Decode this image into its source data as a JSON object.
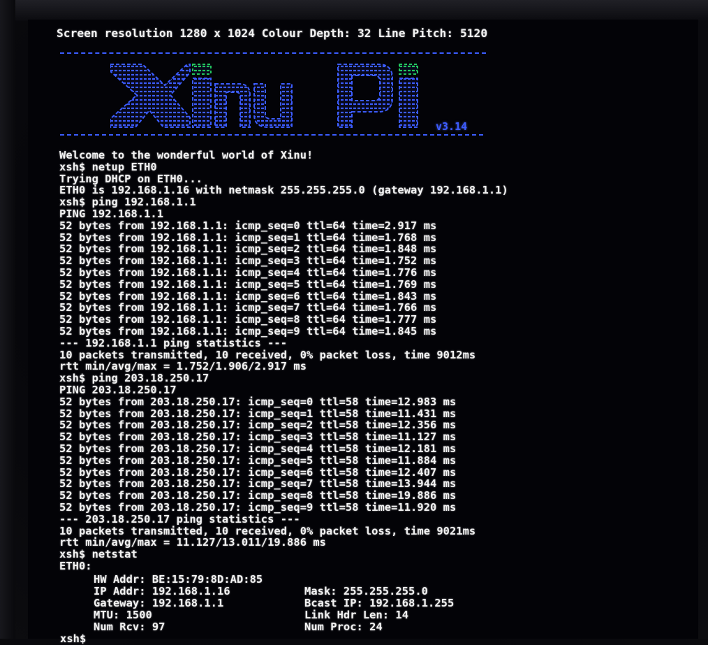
{
  "header": {
    "resolution_line": "Screen resolution 1280 x 1024 Colour Depth: 32 Line Pitch: 5120"
  },
  "logo": {
    "text": "Xinu Pi",
    "version": "v3.14",
    "colors": {
      "primary": "#3b5cff",
      "accent": "#22c55e"
    }
  },
  "console": {
    "lines": [
      "Welcome to the wonderful world of Xinu!",
      "xsh$ netup ETH0",
      "Trying DHCP on ETH0...",
      "ETH0 is 192.168.1.16 with netmask 255.255.255.0 (gateway 192.168.1.1)",
      "xsh$ ping 192.168.1.1",
      "PING 192.168.1.1",
      "52 bytes from 192.168.1.1: icmp_seq=0 ttl=64 time=2.917 ms",
      "52 bytes from 192.168.1.1: icmp_seq=1 ttl=64 time=1.768 ms",
      "52 bytes from 192.168.1.1: icmp_seq=2 ttl=64 time=1.848 ms",
      "52 bytes from 192.168.1.1: icmp_seq=3 ttl=64 time=1.752 ms",
      "52 bytes from 192.168.1.1: icmp_seq=4 ttl=64 time=1.776 ms",
      "52 bytes from 192.168.1.1: icmp_seq=5 ttl=64 time=1.769 ms",
      "52 bytes from 192.168.1.1: icmp_seq=6 ttl=64 time=1.843 ms",
      "52 bytes from 192.168.1.1: icmp_seq=7 ttl=64 time=1.766 ms",
      "52 bytes from 192.168.1.1: icmp_seq=8 ttl=64 time=1.777 ms",
      "52 bytes from 192.168.1.1: icmp_seq=9 ttl=64 time=1.845 ms",
      "--- 192.168.1.1 ping statistics ---",
      "10 packets transmitted, 10 received, 0% packet loss, time 9012ms",
      "rtt min/avg/max = 1.752/1.906/2.917 ms",
      "xsh$ ping 203.18.250.17",
      "PING 203.18.250.17",
      "52 bytes from 203.18.250.17: icmp_seq=0 ttl=58 time=12.983 ms",
      "52 bytes from 203.18.250.17: icmp_seq=1 ttl=58 time=11.431 ms",
      "52 bytes from 203.18.250.17: icmp_seq=2 ttl=58 time=12.356 ms",
      "52 bytes from 203.18.250.17: icmp_seq=3 ttl=58 time=11.127 ms",
      "52 bytes from 203.18.250.17: icmp_seq=4 ttl=58 time=12.181 ms",
      "52 bytes from 203.18.250.17: icmp_seq=5 ttl=58 time=11.884 ms",
      "52 bytes from 203.18.250.17: icmp_seq=6 ttl=58 time=12.407 ms",
      "52 bytes from 203.18.250.17: icmp_seq=7 ttl=58 time=13.944 ms",
      "52 bytes from 203.18.250.17: icmp_seq=8 ttl=58 time=19.886 ms",
      "52 bytes from 203.18.250.17: icmp_seq=9 ttl=58 time=11.920 ms",
      "--- 203.18.250.17 ping statistics ---",
      "10 packets transmitted, 10 received, 0% packet loss, time 9021ms",
      "rtt min/avg/max = 11.127/13.011/19.886 ms",
      "xsh$ netstat",
      "ETH0:"
    ],
    "netstat": {
      "left": [
        "HW Addr: BE:15:79:8D:AD:85",
        "IP Addr: 192.168.1.16",
        "Gateway: 192.168.1.1",
        "MTU: 1500",
        "Num Rcv: 97"
      ],
      "right": [
        "Mask: 255.255.255.0",
        "Bcast IP: 192.168.1.255",
        "Link Hdr Len: 14",
        "Num Proc: 24"
      ]
    },
    "prompt": "xsh$ "
  }
}
